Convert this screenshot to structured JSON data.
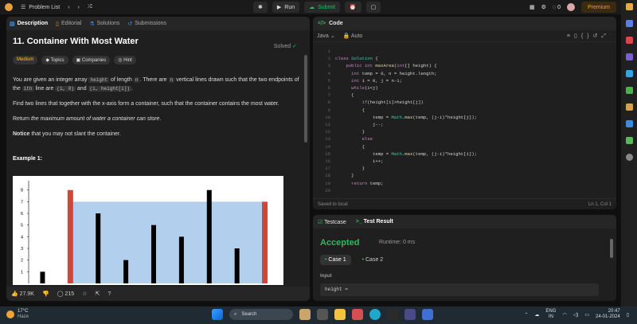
{
  "topbar": {
    "problem_list": "Problem List",
    "run": "Run",
    "submit": "Submit",
    "streak": "0",
    "premium": "Premium"
  },
  "left_tabs": [
    "Description",
    "Editorial",
    "Solutions",
    "Submissions"
  ],
  "problem": {
    "title": "11. Container With Most Water",
    "status": "Solved",
    "chips": [
      "Medium",
      "Topics",
      "Companies",
      "Hint"
    ],
    "p1_a": "You are given an integer array ",
    "p1_code1": "height",
    "p1_b": " of length ",
    "p1_code2": "n",
    "p1_c": ". There are ",
    "p1_code3": "n",
    "p1_d": " vertical lines drawn such that the two endpoints of the ",
    "p1_code4": "ith",
    "p1_e": " line are ",
    "p1_code5": "(i, 0)",
    "p1_f": " and ",
    "p1_code6": "(i, height[i])",
    "p1_g": ".",
    "p2": "Find two lines that together with the x-axis form a container, such that the container contains the most water.",
    "p3_a": "Return ",
    "p3_em": "the maximum amount of water a container can store",
    "p3_b": ".",
    "p4_strong": "Notice",
    "p4_rest": " that you may not slant the container.",
    "example_title": "Example 1:"
  },
  "chart_data": {
    "type": "bar",
    "categories": [
      "1",
      "2",
      "3",
      "4",
      "5",
      "6",
      "7",
      "8",
      "9"
    ],
    "values": [
      1,
      8,
      6,
      2,
      5,
      4,
      8,
      3,
      7
    ],
    "highlight": [
      1,
      8
    ],
    "water_level": 7,
    "ylim": [
      0,
      8.8
    ],
    "yticks": [
      "1",
      "2",
      "3",
      "4",
      "5",
      "6",
      "7",
      "8"
    ],
    "colors": {
      "bar": "#000000",
      "edge": "#d2453b",
      "water": "#b3cfee"
    }
  },
  "left_bottom": {
    "likes": "27.9K",
    "comments": "215"
  },
  "code_panel": {
    "title": "Code",
    "language": "Java",
    "mode": "Auto",
    "status_left": "Saved to local",
    "status_right": "Ln 1, Col 1",
    "line_numbers": [
      "1",
      "2",
      "3",
      "4",
      "5",
      "6",
      "7",
      "8",
      "9",
      "10",
      "11",
      "12",
      "13",
      "14",
      "15",
      "16",
      "17",
      "18",
      "19",
      "20"
    ],
    "lines": [
      "",
      "class Solution {",
      "    public int maxArea(int[] height) {",
      "      int temp = 0, n = height.length;",
      "      int i = 0, j = n-1;",
      "      while(i<j)",
      "      {",
      "          if(height[i]>height[j])",
      "          {",
      "              temp = Math.max(temp, (j-i)*height[j]);",
      "              j--;",
      "          }",
      "          else",
      "          {",
      "              temp = Math.max(temp, (j-i)*height[i]);",
      "              i++;",
      "          }",
      "      }",
      "      return temp;",
      ""
    ]
  },
  "result": {
    "tabs": [
      "Testcase",
      "Test Result"
    ],
    "verdict": "Accepted",
    "runtime": "Runtime: 0 ms",
    "cases": [
      "Case 1",
      "Case 2"
    ],
    "input_label": "Input",
    "input_value": "height ="
  },
  "taskbar": {
    "temp": "17°C",
    "weather": "Haze",
    "search": "Search",
    "lang1": "ENG",
    "lang2": "IN",
    "time": "20:47",
    "date": "24-01-2024"
  }
}
